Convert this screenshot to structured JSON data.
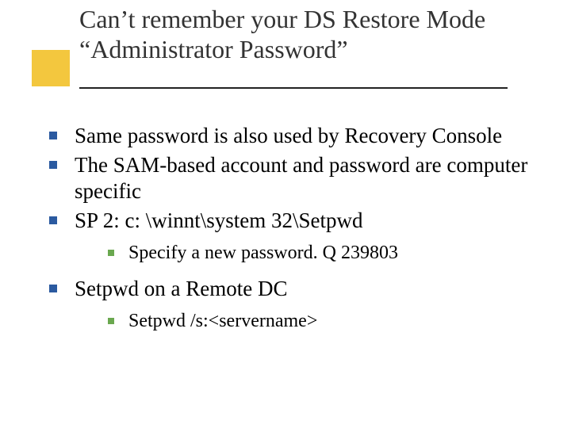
{
  "title": "Can’t remember your DS Restore Mode “Administrator Password”",
  "bullets": [
    {
      "text": "Same password is also used by Recovery Console",
      "sub": []
    },
    {
      "text": "The SAM-based account and password are computer specific",
      "sub": []
    },
    {
      "text": "SP 2: c: \\winnt\\system 32\\Setpwd",
      "sub": [
        "Specify a new password.  Q 239803"
      ]
    },
    {
      "text": "Setpwd on a Remote DC",
      "sub": [
        "Setpwd /s:<servername>"
      ]
    }
  ]
}
